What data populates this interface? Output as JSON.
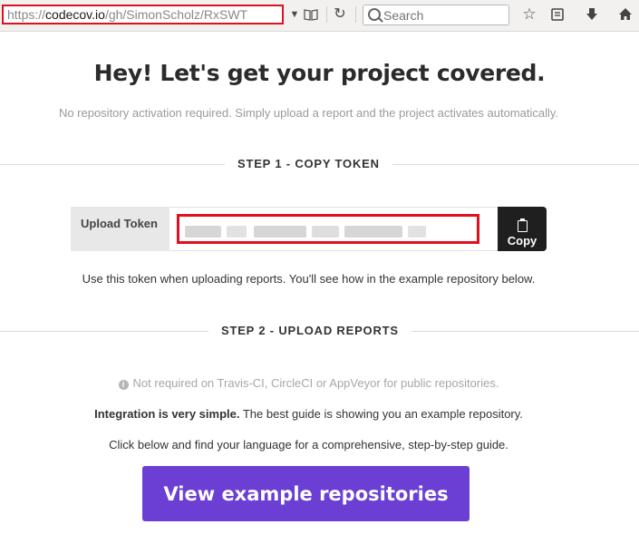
{
  "browser": {
    "url_proto": "https://",
    "url_host": "codecov.io",
    "url_path": "/gh/SimonScholz/RxSWT",
    "search_placeholder": "Search"
  },
  "page": {
    "title": "Hey! Let's get your project covered.",
    "subtitle": "No repository activation required. Simply upload a report and the project activates automatically.",
    "step1_label": "STEP 1 - COPY TOKEN",
    "token_label": "Upload Token",
    "copy_label": "Copy",
    "token_hint": "Use this token when uploading reports. You'll see how in the example repository below.",
    "step2_label": "STEP 2 - UPLOAD REPORTS",
    "info_note": "Not required on Travis-CI, CircleCI or AppVeyor for public repositories.",
    "integration_bold": "Integration is very simple.",
    "integration_rest": " The best guide is showing you an example repository.",
    "guide_text": "Click below and find your language for a comprehensive, step-by-step guide.",
    "cta_label": "View example repositories"
  },
  "colors": {
    "highlight": "#e0101e",
    "cta": "#6b3fd3",
    "copy_button": "#1f1f1f"
  }
}
